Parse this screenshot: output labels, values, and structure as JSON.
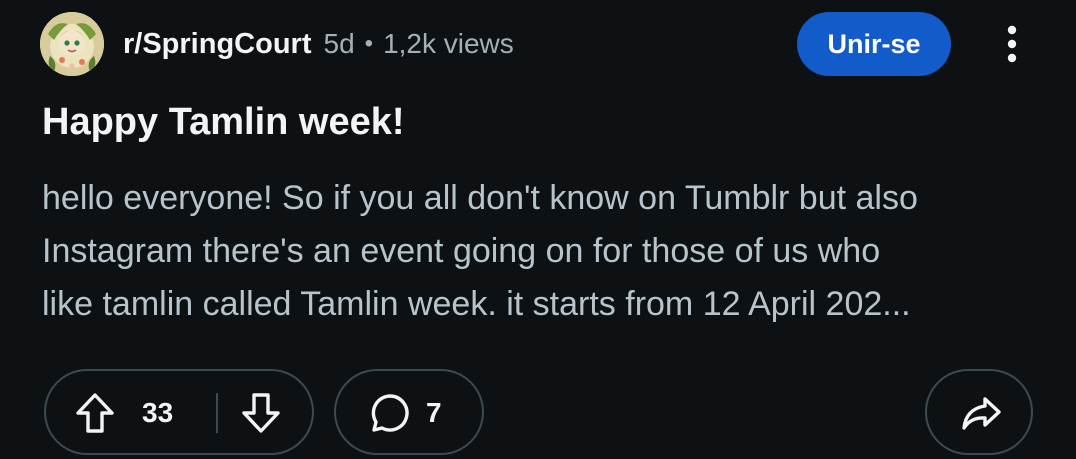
{
  "post": {
    "subreddit": "r/SpringCourt",
    "age": "5d",
    "separator": "•",
    "views": "1,2k views",
    "join_label": "Unir-se",
    "title": "Happy Tamlin week!",
    "body_lines": [
      "hello everyone! So if you all don't know on Tumblr but also",
      "Instagram there's an event going on for those of us who",
      "like tamlin called Tamlin week. it starts from 12 April 202..."
    ]
  },
  "actions": {
    "vote_count": "33",
    "comment_count": "7"
  },
  "icons": {
    "avatar": "subreddit-avatar-icon",
    "more": "more-vertical-icon",
    "upvote": "upvote-arrow-icon",
    "downvote": "downvote-arrow-icon",
    "comment": "comment-bubble-icon",
    "share": "share-arrow-icon"
  },
  "colors": {
    "background": "#0e1113",
    "join_button": "#115bca",
    "text_primary": "#f2f4f5",
    "text_secondary": "#a4b0b7",
    "body_text": "#b7c4cc",
    "pill_border": "#3e4a52"
  }
}
